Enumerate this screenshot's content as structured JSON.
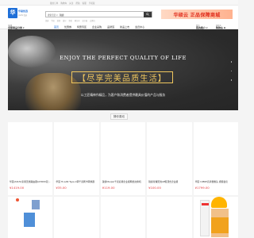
{
  "topbar": {
    "links": [
      "我的订单",
      "购物车",
      "关注",
      "帮助",
      "客服",
      "手机版"
    ]
  },
  "logo": {
    "mark": "华",
    "name": "华硕优选",
    "sub": "ASUS 优选"
  },
  "search": {
    "category": "搜索宝贝 ▾",
    "value": "锐捷",
    "button_icon": "search-icon"
  },
  "hotwords": [
    "锐捷",
    "华硕",
    "联想",
    "戴尔",
    "惠普",
    "笔记本",
    "显示器",
    "交换机"
  ],
  "promo": {
    "text": "华硕云  正品保障商城"
  },
  "nav": {
    "cats_line1": "全部",
    "cats_label": "全部商品分类 ▾",
    "menu": [
      "首页",
      "优惠券",
      "特惠专区",
      "企业采购",
      "品牌馆",
      "新品上市",
      "会员中心"
    ],
    "right": [
      {
        "line1": "我的",
        "line2": "我的账户 ▾"
      },
      {
        "line1": "购物车",
        "line2": "购物车 0"
      }
    ]
  },
  "banner": {
    "en": "ENJOY THE PERFECT QUALITY OF LIFE",
    "zh": "【尽享完美品质生活】",
    "desc": "以工匠精神作精品，为客户和消费者提供最具价值的产品与服务"
  },
  "section": {
    "title": "猜你喜欢"
  },
  "products": [
    {
      "title": "华硕(ASUS)家用无线路由器AX3000双频千兆",
      "price": "¥1419.00"
    },
    {
      "title": "华硕 Hi-LAN Type-C转千兆网卡转换器",
      "price": "¥35.00"
    },
    {
      "title": "锐捷(Ruijie)千兆商用企业级网络交换机",
      "price": "¥119.00"
    },
    {
      "title": "锐捷星耀无线AP吸顶式企业级",
      "price": "¥100.00"
    },
    {
      "title": "华硕 1080P高清摄像头 视频会议",
      "price": "¥1799.00"
    }
  ],
  "colors": {
    "brand": "#1e6fd8",
    "price": "#e4393c",
    "banner_gold": "#f0c75e",
    "promo": "#e02a1a"
  }
}
